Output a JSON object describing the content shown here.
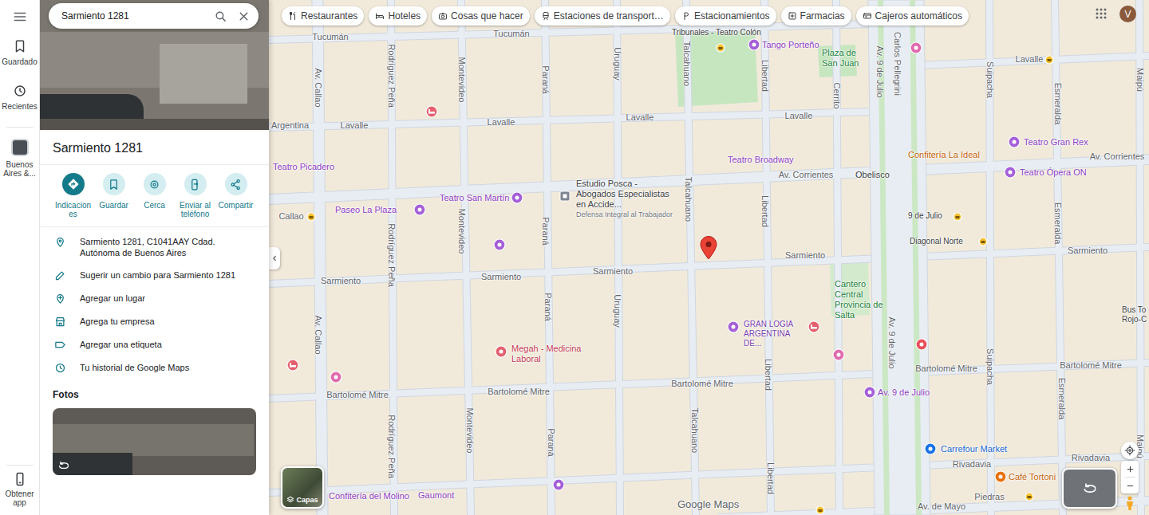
{
  "search": {
    "value": "Sarmiento 1281"
  },
  "rail": {
    "items": [
      {
        "label": "Guardado",
        "kind": "saved"
      },
      {
        "label": "Recientes",
        "kind": "recent"
      },
      {
        "label": "Buenos Aires &...",
        "kind": "place"
      }
    ],
    "bottom_label": "Obtener app"
  },
  "place": {
    "title": "Sarmiento 1281",
    "actions": [
      {
        "label": "Indicaciones",
        "kind": "primary"
      },
      {
        "label": "Guardar",
        "kind": "secondary"
      },
      {
        "label": "Cerca",
        "kind": "secondary"
      },
      {
        "label": "Enviar al teléfono",
        "kind": "secondary"
      },
      {
        "label": "Compartir",
        "kind": "secondary"
      }
    ],
    "details": [
      {
        "text": "Sarmiento 1281, C1041AAY Cdad. Autónoma de Buenos Aires",
        "kind": "address"
      },
      {
        "text": "Sugerir un cambio para Sarmiento 1281",
        "kind": "edit"
      },
      {
        "text": "Agregar un lugar",
        "kind": "add-place"
      },
      {
        "text": "Agrega tu empresa",
        "kind": "business"
      },
      {
        "text": "Agregar una etiqueta",
        "kind": "label"
      },
      {
        "text": "Tu historial de Google Maps",
        "kind": "history"
      }
    ],
    "photos_heading": "Fotos"
  },
  "categories": [
    {
      "label": "Restaurantes",
      "kind": "restaurant"
    },
    {
      "label": "Hoteles",
      "kind": "hotel"
    },
    {
      "label": "Cosas que hacer",
      "kind": "things"
    },
    {
      "label": "Estaciones de transport…",
      "kind": "transit"
    },
    {
      "label": "Estacionamientos",
      "kind": "parking"
    },
    {
      "label": "Farmacias",
      "kind": "pharmacy"
    },
    {
      "label": "Cajeros automáticos",
      "kind": "atm"
    }
  ],
  "account": {
    "initial": "V"
  },
  "map": {
    "streets": [
      {
        "text": "Tucumán",
        "kind": "h"
      },
      {
        "text": "Tucumán",
        "kind": "h"
      },
      {
        "text": "Lavalle",
        "kind": "h"
      },
      {
        "text": "Lavalle",
        "kind": "h"
      },
      {
        "text": "Lavalle",
        "kind": "h"
      },
      {
        "text": "Lavalle",
        "kind": "h"
      },
      {
        "text": "Lavalle",
        "kind": "h"
      },
      {
        "text": "Av. Corrientes",
        "kind": "h"
      },
      {
        "text": "Av. Corrientes",
        "kind": "h"
      },
      {
        "text": "Callao",
        "kind": "h"
      },
      {
        "text": "Sarmiento",
        "kind": "h"
      },
      {
        "text": "Sarmiento",
        "kind": "h"
      },
      {
        "text": "Sarmiento",
        "kind": "h"
      },
      {
        "text": "Sarmiento",
        "kind": "h"
      },
      {
        "text": "Sarmiento",
        "kind": "h"
      },
      {
        "text": "Bartolomé Mitre",
        "kind": "h"
      },
      {
        "text": "Bartolomé Mitre",
        "kind": "h"
      },
      {
        "text": "Bartolomé Mitre",
        "kind": "h"
      },
      {
        "text": "Bartolomé Mitre",
        "kind": "h"
      },
      {
        "text": "Bartolomé Mitre",
        "kind": "h"
      },
      {
        "text": "Rivadavia",
        "kind": "h"
      },
      {
        "text": "Rivadavia",
        "kind": "h"
      },
      {
        "text": "Av. de Mayo",
        "kind": "h"
      },
      {
        "text": "Piedras",
        "kind": "h"
      },
      {
        "text": "Av. Callao",
        "kind": "v"
      },
      {
        "text": "Av. Callao",
        "kind": "v"
      },
      {
        "text": "Rodríguez Peña",
        "kind": "v"
      },
      {
        "text": "Rodríguez Peña",
        "kind": "v"
      },
      {
        "text": "Rodríguez Peña",
        "kind": "v"
      },
      {
        "text": "Montevideo",
        "kind": "v"
      },
      {
        "text": "Montevideo",
        "kind": "v"
      },
      {
        "text": "Montevideo",
        "kind": "v"
      },
      {
        "text": "Paraná",
        "kind": "v"
      },
      {
        "text": "Paraná",
        "kind": "v"
      },
      {
        "text": "Paraná",
        "kind": "v"
      },
      {
        "text": "Paraná",
        "kind": "v"
      },
      {
        "text": "Uruguay",
        "kind": "v"
      },
      {
        "text": "Uruguay",
        "kind": "v"
      },
      {
        "text": "Talcahuano",
        "kind": "v"
      },
      {
        "text": "Talcahuano",
        "kind": "v"
      },
      {
        "text": "Talcahuano",
        "kind": "v"
      },
      {
        "text": "Libertad",
        "kind": "v"
      },
      {
        "text": "Libertad",
        "kind": "v"
      },
      {
        "text": "Libertad",
        "kind": "v"
      },
      {
        "text": "Libertad",
        "kind": "v"
      },
      {
        "text": "Cerrito",
        "kind": "v"
      },
      {
        "text": "Carlos Pellegrini",
        "kind": "v"
      },
      {
        "text": "Av. 9 de Julio",
        "kind": "v"
      },
      {
        "text": "Av. 9 de Julio",
        "kind": "v"
      },
      {
        "text": "Suipacha",
        "kind": "v"
      },
      {
        "text": "Suipacha",
        "kind": "v"
      },
      {
        "text": "Esmeralda",
        "kind": "v"
      },
      {
        "text": "Esmeralda",
        "kind": "v"
      },
      {
        "text": "Esmeralda",
        "kind": "v"
      },
      {
        "text": "Maipú",
        "kind": "v"
      },
      {
        "text": "Maipú",
        "kind": "v"
      }
    ],
    "places": [
      {
        "name": "Tango Porteño",
        "kind": "theater"
      },
      {
        "name": "Tribunales - Teatro Colón",
        "kind": "transit"
      },
      {
        "name": "Plaza de San Juan",
        "kind": "park"
      },
      {
        "name": "Argentina",
        "kind": "plain"
      },
      {
        "name": "Teatro Picadero",
        "kind": "theater"
      },
      {
        "name": "Estudio Posca - Abogados Especialistas en Accide...",
        "subtitle": "Defensa Integral al Trabajador",
        "kind": "office"
      },
      {
        "name": "Teatro Broadway",
        "kind": "theater"
      },
      {
        "name": "Teatro San Martín",
        "kind": "theater"
      },
      {
        "name": "Paseo La Plaza",
        "kind": "theater"
      },
      {
        "name": "Obelisco",
        "kind": "landmark"
      },
      {
        "name": "Confitería La Ideal",
        "kind": "food"
      },
      {
        "name": "Teatro Gran Rex",
        "kind": "theater"
      },
      {
        "name": "Teatro Ópera ON",
        "kind": "theater"
      },
      {
        "name": "9 de Julio",
        "kind": "transit"
      },
      {
        "name": "Diagonal Norte",
        "kind": "transit"
      },
      {
        "name": "Cantero Central Provincia de Salta",
        "kind": "park"
      },
      {
        "name": "GRAN LOGIA ARGENTINA DE...",
        "kind": "lodge"
      },
      {
        "name": "Megah - Medicina Laboral",
        "kind": "medical"
      },
      {
        "name": "Av. 9 de Julio",
        "kind": "theater"
      },
      {
        "name": "Carrefour Market",
        "kind": "grocery"
      },
      {
        "name": "Café Tortoni",
        "kind": "food"
      },
      {
        "name": "Confitería del Molino",
        "kind": "theater"
      },
      {
        "name": "Gaumont",
        "kind": "theater"
      },
      {
        "name": "Bus To\nRojo-C",
        "kind": "transit"
      }
    ],
    "markers": [
      {
        "kind": "hotel"
      },
      {
        "kind": "hotel"
      },
      {
        "kind": "hotel"
      },
      {
        "kind": "shop"
      },
      {
        "kind": "shop"
      },
      {
        "kind": "shop"
      },
      {
        "kind": "bank"
      },
      {
        "kind": "bank"
      },
      {
        "kind": "bank"
      },
      {
        "kind": "bank"
      },
      {
        "kind": "bank"
      },
      {
        "kind": "bank"
      },
      {
        "kind": "bank"
      },
      {
        "kind": "theater"
      },
      {
        "kind": "theater"
      },
      {
        "kind": "attraction"
      }
    ],
    "layers_label": "Capas",
    "logo": "Google Maps"
  }
}
